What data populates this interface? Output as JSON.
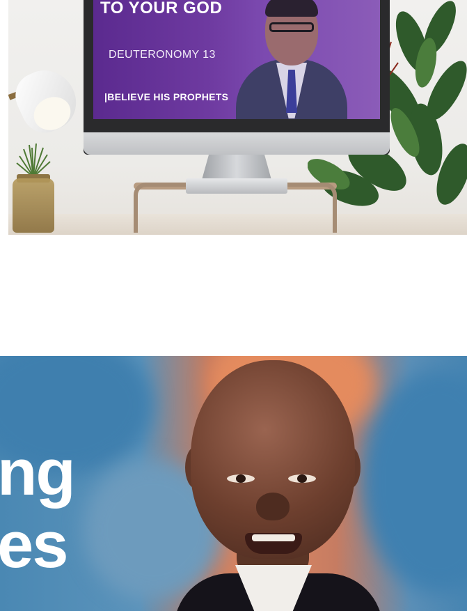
{
  "top_thumbnail": {
    "slide_title": "TO YOUR GOD",
    "slide_reference": "DEUTERONOMY 13",
    "slide_tagline": "|BELIEVE HIS PROPHETS"
  },
  "bottom_thumbnail": {
    "title_line_1": "ng",
    "title_line_2": "es"
  },
  "colors": {
    "slide_purple": "#6e3aa0",
    "sky_blue": "#4a88b3",
    "sunset_orange": "#e08a63"
  }
}
